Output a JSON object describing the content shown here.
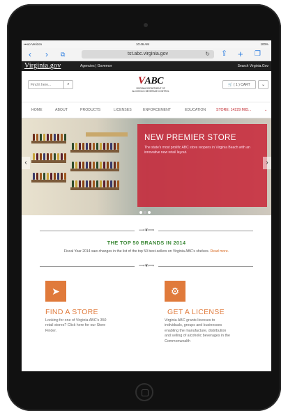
{
  "statusbar": {
    "carrier": "•••oo Verizon",
    "time": "10:46 AM",
    "battery": "100%"
  },
  "browser": {
    "url": "tst.abc.virginia.gov",
    "back_icon": "chevron-left-icon",
    "forward_icon": "chevron-right-icon"
  },
  "gov_bar": {
    "logo": "Virginia.gov",
    "links": "Agencies | Governor",
    "search": "Search Virginia.Gov"
  },
  "header": {
    "find_placeholder": "Find it here...",
    "logo_mark": "ABC",
    "logo_sub1": "VIRGINIA DEPARTMENT OF",
    "logo_sub2": "ALCOHOLIC BEVERAGE CONTROL",
    "cart_label": "( 1 ) CART"
  },
  "nav": {
    "items": [
      "HOME",
      "ABOUT",
      "PRODUCTS",
      "LICENSES",
      "ENFORCEMENT",
      "EDUCATION"
    ],
    "store": "STORE: 14229 MID...",
    "store_color": "#c0282e"
  },
  "hero": {
    "title": "NEW PREMIER STORE",
    "text": "The state's most prolific ABC store reopens in Virginia Beach with an innovative new retail layout.",
    "promo_color": "#c81e32"
  },
  "top50": {
    "title": "THE TOP 50 BRANDS IN 2014",
    "text": "Fiscal Year 2014 saw changes in the list of the top 50 best-sellers on Virginia ABC's shelves.",
    "link": "Read more."
  },
  "cards": {
    "find_store": {
      "title": "FIND A STORE",
      "text": "Looking for one of Virginia ABC's 350 retail stores? Click here for our Store Finder."
    },
    "license": {
      "title": "GET A LICENSE",
      "text": "Virginia ABC grants licenses to individuals, groups and businesses enabling the manufacture, distribution and selling of alcoholic beverages in the Commonwealth"
    }
  },
  "accent_color": "#e07a3b"
}
